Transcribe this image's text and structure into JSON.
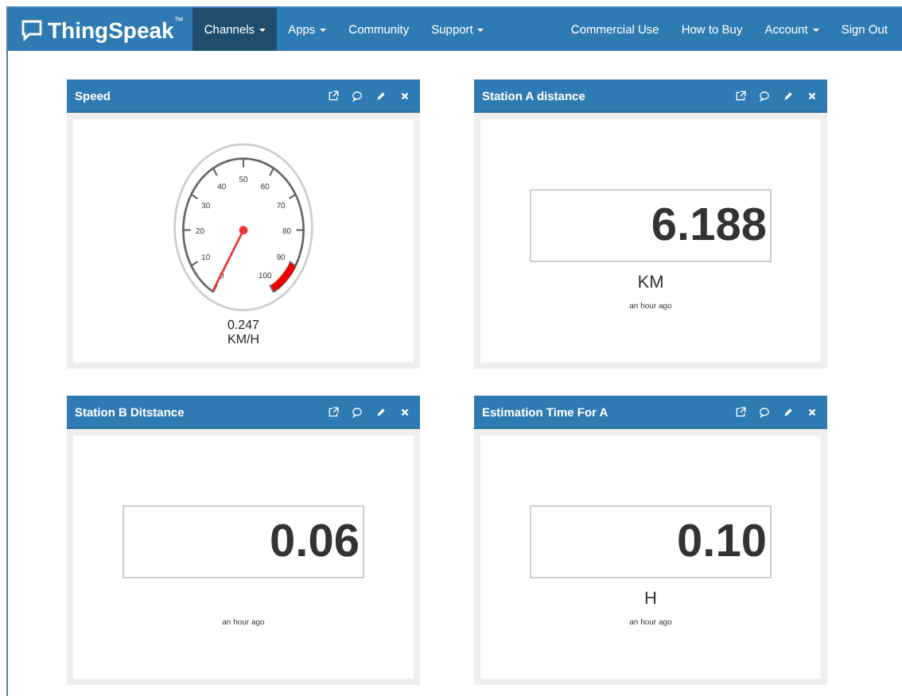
{
  "navbar": {
    "brand": "ThingSpeak",
    "brand_mark": "™",
    "left_items": [
      {
        "label": "Channels",
        "dropdown": true,
        "selected": true
      },
      {
        "label": "Apps",
        "dropdown": true,
        "selected": false
      },
      {
        "label": "Community",
        "dropdown": false,
        "selected": false
      },
      {
        "label": "Support",
        "dropdown": true,
        "selected": false
      }
    ],
    "right_items": [
      {
        "label": "Commercial Use",
        "dropdown": false,
        "selected": false
      },
      {
        "label": "How to Buy",
        "dropdown": false,
        "selected": false
      },
      {
        "label": "Account",
        "dropdown": true,
        "selected": false
      },
      {
        "label": "Sign Out",
        "dropdown": false,
        "selected": false
      }
    ]
  },
  "widgets": [
    {
      "kind": "gauge",
      "title": "Speed",
      "scale_labels": [
        "0",
        "10",
        "20",
        "30",
        "40",
        "50",
        "60",
        "70",
        "80",
        "90",
        "100"
      ],
      "value": "0.247",
      "unit": "KM/H"
    },
    {
      "kind": "numeric",
      "title": "Station A distance",
      "value": "6.188",
      "unit": "KM",
      "updated": "an hour ago"
    },
    {
      "kind": "numeric",
      "title": "Station B Ditstance",
      "value": "0.06",
      "updated": "an hour ago"
    },
    {
      "kind": "numeric",
      "title": "Estimation Time For A",
      "value": "0.10",
      "unit": "H",
      "updated": "an hour ago"
    }
  ]
}
